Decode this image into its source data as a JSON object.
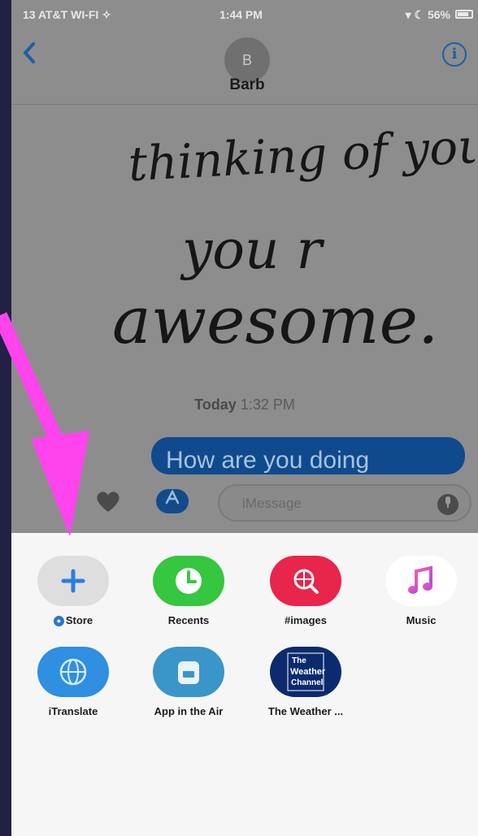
{
  "status_bar": {
    "carrier": "13 AT&T WI-FI ✧",
    "time": "1:44 PM",
    "battery": "▾ ☾ 56%"
  },
  "header": {
    "back_icon": "chevron-left-icon",
    "avatar_initial": "B",
    "contact_name": "Barb",
    "info_icon": "i"
  },
  "conversation": {
    "handwritten_lines": [
      "thinking of you",
      "you r",
      "awesome."
    ],
    "timestamp_day": "Today",
    "timestamp_time": "1:32 PM",
    "outgoing_message": "How are you doing"
  },
  "compose": {
    "heart_icon": "digital-touch-heart-icon",
    "apps_icon": "app-store-icon",
    "placeholder": "iMessage",
    "mic_icon": "microphone-icon"
  },
  "apps": [
    {
      "label": "Store",
      "icon": "plus-icon",
      "color": "#dedede"
    },
    {
      "label": "Recents",
      "icon": "clock-icon",
      "color": "#34c73f"
    },
    {
      "label": "#images",
      "icon": "globe-search-icon",
      "color": "#e8254b"
    },
    {
      "label": "Music",
      "icon": "music-note-icon",
      "color": "#ffffff"
    },
    {
      "label": "iTranslate",
      "icon": "translate-globe-icon",
      "color": "#2f8fe0"
    },
    {
      "label": "App in the Air",
      "icon": "suitcase-icon",
      "color": "#3a96c8"
    },
    {
      "label": "The Weather ...",
      "icon": "weather-channel-icon",
      "color": "#0c2b6e"
    }
  ],
  "weather_logo_text": [
    "The",
    "Weather",
    "Channel"
  ],
  "colors": {
    "accent_blue": "#1a5fa8",
    "annotation_arrow": "#ff44ee"
  }
}
